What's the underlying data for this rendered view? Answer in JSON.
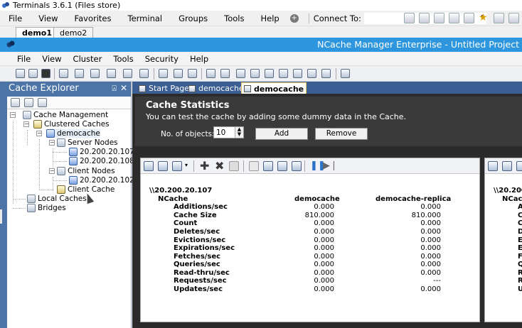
{
  "terminals": {
    "title": "Terminals 3.6.1 (Files store)",
    "menu": [
      "File",
      "View",
      "Favorites",
      "Terminal",
      "Groups",
      "Tools",
      "Help"
    ],
    "connect_label": "Connect To:",
    "connect_value": "",
    "tabs": [
      {
        "label": "demo1",
        "active": true
      },
      {
        "label": "demo2",
        "active": false
      }
    ]
  },
  "ncache": {
    "title": "NCache Manager Enterprise - Untitled Project",
    "menu": [
      "File",
      "View",
      "Cluster",
      "Tools",
      "Security",
      "Help"
    ]
  },
  "explorer": {
    "title": "Cache Explorer",
    "pin": "⍓",
    "close": "✕",
    "tree": [
      {
        "label": "Cache Management",
        "level": 0,
        "icon": "cache-management-icon"
      },
      {
        "label": "Clustered Caches",
        "level": 1,
        "icon": "clustered-caches-icon"
      },
      {
        "label": "democache",
        "level": 2,
        "icon": "cache-icon",
        "selected": true
      },
      {
        "label": "Server Nodes",
        "level": 3,
        "icon": "server-nodes-icon"
      },
      {
        "label": "20.200.20.107",
        "level": 4,
        "icon": "server-icon"
      },
      {
        "label": "20.200.20.108",
        "level": 4,
        "icon": "server-icon"
      },
      {
        "label": "Client Nodes",
        "level": 3,
        "icon": "client-nodes-icon"
      },
      {
        "label": "20.200.20.102",
        "level": 4,
        "icon": "server-icon"
      },
      {
        "label": "Client Cache",
        "level": 3,
        "icon": "client-cache-icon"
      },
      {
        "label": "Local Caches",
        "level": 1,
        "icon": "local-caches-icon"
      },
      {
        "label": "Bridges",
        "level": 1,
        "icon": "bridges-icon"
      }
    ]
  },
  "doc_tabs": [
    {
      "label": "Start Page",
      "active": false
    },
    {
      "label": "democache",
      "active": false
    },
    {
      "label": "democache",
      "active": true
    }
  ],
  "stats_form": {
    "title": "Cache Statistics",
    "subtitle": "You can test the cache by adding some dummy data in the Cache.",
    "objects_label": "No. of objects:",
    "objects_value": "10",
    "add_label": "Add",
    "remove_label": "Remove"
  },
  "stats_panel": {
    "server": "\\\\20.200.20.107",
    "category": "NCache",
    "columns": [
      "democache",
      "democache-replica"
    ],
    "rows": [
      {
        "counter": "Additions/sec",
        "v1": "0.000",
        "v2": "0.000"
      },
      {
        "counter": "Cache Size",
        "v1": "810.000",
        "v2": "810.000"
      },
      {
        "counter": "Count",
        "v1": "0.000",
        "v2": "0.000"
      },
      {
        "counter": "Deletes/sec",
        "v1": "0.000",
        "v2": "0.000"
      },
      {
        "counter": "Evictions/sec",
        "v1": "0.000",
        "v2": "0.000"
      },
      {
        "counter": "Expirations/sec",
        "v1": "0.000",
        "v2": "0.000"
      },
      {
        "counter": "Fetches/sec",
        "v1": "0.000",
        "v2": "0.000"
      },
      {
        "counter": "Queries/sec",
        "v1": "0.000",
        "v2": "0.000"
      },
      {
        "counter": "Read-thru/sec",
        "v1": "0.000",
        "v2": "0.000"
      },
      {
        "counter": "Requests/sec",
        "v1": "0.000",
        "v2": "---"
      },
      {
        "counter": "Updates/sec",
        "v1": "0.000",
        "v2": "0.000"
      }
    ]
  },
  "stats_panel2": {
    "server": "\\\\20.200",
    "category": "NCach",
    "rows": [
      "A",
      "C",
      "C",
      "D",
      "E",
      "E",
      "F",
      "Q",
      "R",
      "R",
      "U"
    ]
  }
}
